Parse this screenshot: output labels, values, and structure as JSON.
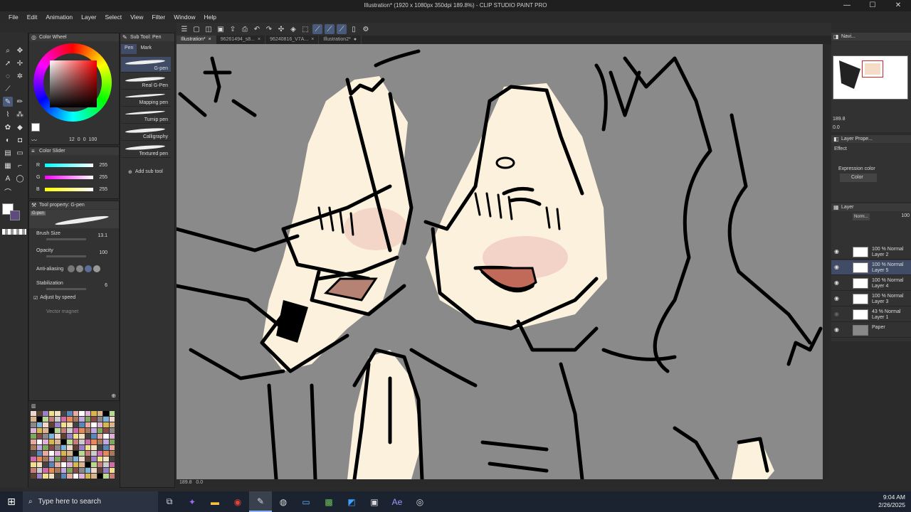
{
  "window": {
    "title": "Illustration* (1920 x 1080px 350dpi 189.8%) - CLIP STUDIO PAINT PRO",
    "minimize": "—",
    "maximize": "☐",
    "close": "✕"
  },
  "menu": [
    "File",
    "Edit",
    "Animation",
    "Layer",
    "Select",
    "View",
    "Filter",
    "Window",
    "Help"
  ],
  "doc_tabs": [
    "Illustration*",
    "96261494_s8...",
    "96240816_V7A...",
    "Illustration2*"
  ],
  "panels": {
    "color_wheel": {
      "title": "Color Wheel",
      "h": "12",
      "s": "0",
      "v": "0",
      "v2": "100"
    },
    "color_slider": {
      "title": "Color Slider",
      "r_label": "R",
      "r": "255",
      "g_label": "G",
      "g": "255",
      "b_label": "B",
      "b": "255"
    },
    "sub_tool": {
      "title": "Sub Tool: Pen",
      "tabs": [
        "Pen",
        "Mark"
      ],
      "brushes": [
        "G-pen",
        "Real G-Pen",
        "Mapping pen",
        "Turnip pen",
        "Calligraphy",
        "Textured pen"
      ],
      "add_label": "Add sub tool"
    },
    "tool_property": {
      "title": "Tool property: G-pen",
      "brush_name": "G-pen",
      "brush_size_label": "Brush Size",
      "brush_size": "13.1",
      "opacity_label": "Opacity",
      "opacity": "100",
      "anti_aliasing_label": "Anti-aliasing",
      "stabilization_label": "Stabilization",
      "stabilization": "6",
      "adjust_speed_label": "Adjust by speed",
      "vector_magnet_label": "Vector magnet"
    },
    "navigator": {
      "title": "Navi...",
      "zoom": "189.8",
      "rotation": "0.0"
    },
    "layer_property": {
      "title": "Layer Prope...",
      "effect_label": "Effect",
      "expression_label": "Expression color",
      "expression_value": "Color"
    },
    "layer": {
      "title": "Layer",
      "blend": "Norm...",
      "opacity": "100",
      "rows": [
        {
          "l1": "100 % Normal",
          "l2": "Layer 2"
        },
        {
          "l1": "100 % Normal",
          "l2": "Layer 5"
        },
        {
          "l1": "100 % Normal",
          "l2": "Layer 4"
        },
        {
          "l1": "100 % Normal",
          "l2": "Layer 3"
        },
        {
          "l1": "43 % Normal",
          "l2": "Layer 1"
        },
        {
          "l1": "",
          "l2": "Paper"
        }
      ]
    }
  },
  "status": {
    "zoom": "189.8",
    "angle": "0.0"
  },
  "taskbar": {
    "search_placeholder": "Type here to search",
    "time": "9:04 AM",
    "date": "2/26/2025"
  },
  "colors": {
    "accent": "#404c66",
    "canvas_bg": "#8a8a8a",
    "skin": "#fbf1dc",
    "blush": "#f0c4bd"
  }
}
